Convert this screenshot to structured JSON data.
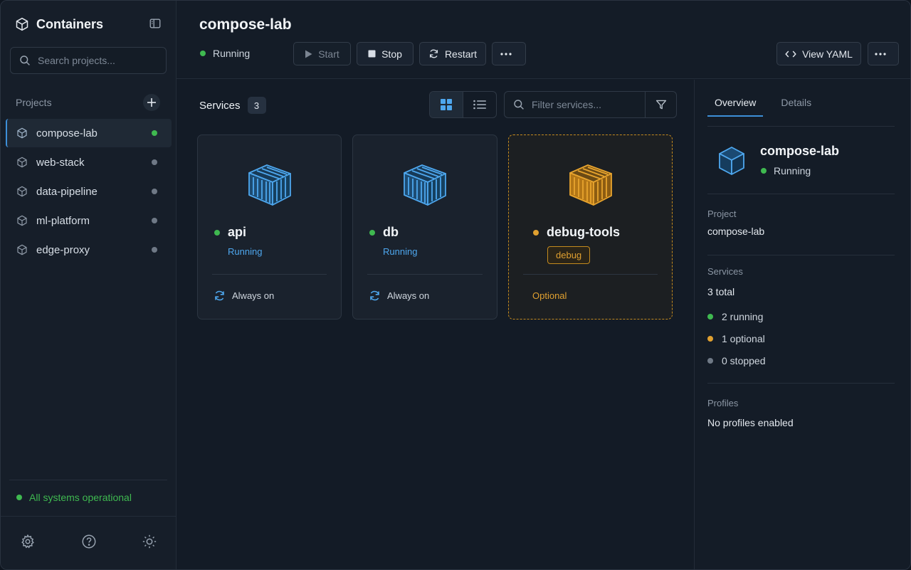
{
  "sidebar": {
    "title": "Containers",
    "search_placeholder": "Search projects...",
    "projects_label": "Projects",
    "projects": [
      {
        "label": "compose-lab",
        "status": "running"
      },
      {
        "label": "web-stack",
        "status": "idle"
      },
      {
        "label": "data-pipeline",
        "status": "idle"
      },
      {
        "label": "ml-platform",
        "status": "idle"
      },
      {
        "label": "edge-proxy",
        "status": "idle"
      }
    ],
    "system_status": "All systems operational"
  },
  "header": {
    "title": "compose-lab",
    "status": "Running",
    "start_label": "Start",
    "stop_label": "Stop",
    "restart_label": "Restart",
    "view_yaml_label": "View YAML"
  },
  "services": {
    "label": "Services",
    "count": "3",
    "filter_placeholder": "Filter services...",
    "cards": [
      {
        "name": "api",
        "state": "Running",
        "footer": "Always on"
      },
      {
        "name": "db",
        "state": "Running",
        "footer": "Always on"
      },
      {
        "name": "debug-tools",
        "tag": "debug",
        "footer": "Optional"
      }
    ]
  },
  "panel": {
    "tab_overview": "Overview",
    "tab_details": "Details",
    "name": "compose-lab",
    "status": "Running",
    "project_label": "Project",
    "project_value": "compose-lab",
    "services_label": "Services",
    "services_total": "3 total",
    "running": "2 running",
    "optional": "1 optional",
    "stopped": "0 stopped",
    "profiles_label": "Profiles",
    "profiles_value": "No profiles enabled"
  },
  "colors": {
    "accent": "#3d8fd8",
    "running": "#3fb950",
    "optional": "#e0a030",
    "stopped": "#6f7986",
    "service_blue": "#4ea7ee"
  }
}
